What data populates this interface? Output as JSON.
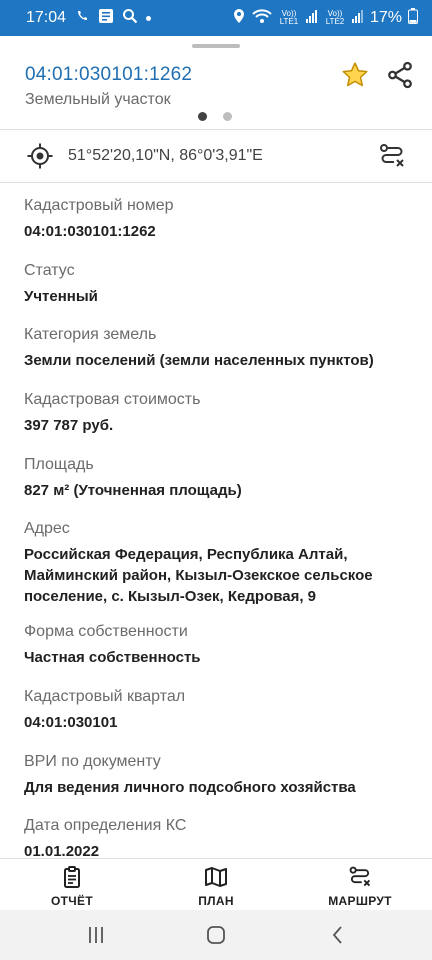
{
  "status_bar": {
    "time": "17:04",
    "signal_label_1": "Vo)) LTE1",
    "signal_label_2": "Vo)) LTE2",
    "battery": "17%"
  },
  "header": {
    "title": "04:01:030101:1262",
    "subtitle": "Земельный участок",
    "favorite_icon": "star-outline-icon",
    "share_icon": "share-icon",
    "accent_color": "#1f6fb2",
    "star_color": "#d4a017"
  },
  "coords": {
    "text": "51°52'20,10\"N, 86°0'3,91\"E"
  },
  "fields": [
    {
      "label": "Кадастровый номер",
      "value": "04:01:030101:1262"
    },
    {
      "label": "Статус",
      "value": "Учтенный"
    },
    {
      "label": "Категория земель",
      "value": "Земли поселений (земли населенных пунктов)"
    },
    {
      "label": "Кадастровая стоимость",
      "value": "397 787 руб."
    },
    {
      "label": "Площадь",
      "value": "827 м² (Уточненная площадь)"
    },
    {
      "label": "Адрес",
      "value": "Российская Федерация, Республика Алтай, Майминский район, Кызыл-Озекское сельское поселение, с. Кызыл-Озек, Кедровая, 9"
    },
    {
      "label": "Форма собственности",
      "value": "Частная собственность"
    },
    {
      "label": "Кадастровый квартал",
      "value": "04:01:030101"
    },
    {
      "label": "ВРИ по документу",
      "value": "Для ведения личного подсобного хозяйства"
    },
    {
      "label": "Дата определения КС",
      "value": "01.01.2022"
    }
  ],
  "actions": {
    "report": "ОТЧЁТ",
    "plan": "ПЛАН",
    "route": "МАРШРУТ"
  }
}
